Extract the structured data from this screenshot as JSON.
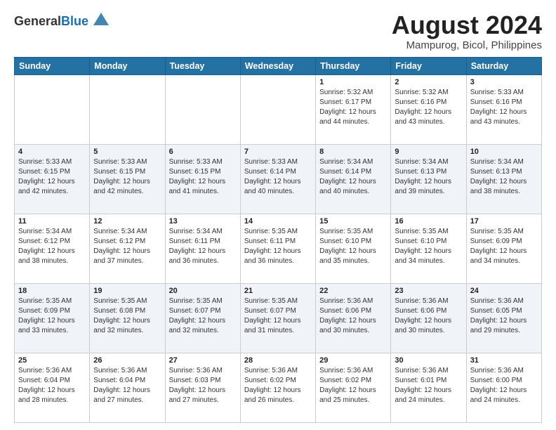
{
  "header": {
    "logo_general": "General",
    "logo_blue": "Blue",
    "month_year": "August 2024",
    "location": "Mampurog, Bicol, Philippines"
  },
  "weekdays": [
    "Sunday",
    "Monday",
    "Tuesday",
    "Wednesday",
    "Thursday",
    "Friday",
    "Saturday"
  ],
  "weeks": [
    [
      {
        "day": "",
        "info": ""
      },
      {
        "day": "",
        "info": ""
      },
      {
        "day": "",
        "info": ""
      },
      {
        "day": "",
        "info": ""
      },
      {
        "day": "1",
        "info": "Sunrise: 5:32 AM\nSunset: 6:17 PM\nDaylight: 12 hours\nand 44 minutes."
      },
      {
        "day": "2",
        "info": "Sunrise: 5:32 AM\nSunset: 6:16 PM\nDaylight: 12 hours\nand 43 minutes."
      },
      {
        "day": "3",
        "info": "Sunrise: 5:33 AM\nSunset: 6:16 PM\nDaylight: 12 hours\nand 43 minutes."
      }
    ],
    [
      {
        "day": "4",
        "info": "Sunrise: 5:33 AM\nSunset: 6:15 PM\nDaylight: 12 hours\nand 42 minutes."
      },
      {
        "day": "5",
        "info": "Sunrise: 5:33 AM\nSunset: 6:15 PM\nDaylight: 12 hours\nand 42 minutes."
      },
      {
        "day": "6",
        "info": "Sunrise: 5:33 AM\nSunset: 6:15 PM\nDaylight: 12 hours\nand 41 minutes."
      },
      {
        "day": "7",
        "info": "Sunrise: 5:33 AM\nSunset: 6:14 PM\nDaylight: 12 hours\nand 40 minutes."
      },
      {
        "day": "8",
        "info": "Sunrise: 5:34 AM\nSunset: 6:14 PM\nDaylight: 12 hours\nand 40 minutes."
      },
      {
        "day": "9",
        "info": "Sunrise: 5:34 AM\nSunset: 6:13 PM\nDaylight: 12 hours\nand 39 minutes."
      },
      {
        "day": "10",
        "info": "Sunrise: 5:34 AM\nSunset: 6:13 PM\nDaylight: 12 hours\nand 38 minutes."
      }
    ],
    [
      {
        "day": "11",
        "info": "Sunrise: 5:34 AM\nSunset: 6:12 PM\nDaylight: 12 hours\nand 38 minutes."
      },
      {
        "day": "12",
        "info": "Sunrise: 5:34 AM\nSunset: 6:12 PM\nDaylight: 12 hours\nand 37 minutes."
      },
      {
        "day": "13",
        "info": "Sunrise: 5:34 AM\nSunset: 6:11 PM\nDaylight: 12 hours\nand 36 minutes."
      },
      {
        "day": "14",
        "info": "Sunrise: 5:35 AM\nSunset: 6:11 PM\nDaylight: 12 hours\nand 36 minutes."
      },
      {
        "day": "15",
        "info": "Sunrise: 5:35 AM\nSunset: 6:10 PM\nDaylight: 12 hours\nand 35 minutes."
      },
      {
        "day": "16",
        "info": "Sunrise: 5:35 AM\nSunset: 6:10 PM\nDaylight: 12 hours\nand 34 minutes."
      },
      {
        "day": "17",
        "info": "Sunrise: 5:35 AM\nSunset: 6:09 PM\nDaylight: 12 hours\nand 34 minutes."
      }
    ],
    [
      {
        "day": "18",
        "info": "Sunrise: 5:35 AM\nSunset: 6:09 PM\nDaylight: 12 hours\nand 33 minutes."
      },
      {
        "day": "19",
        "info": "Sunrise: 5:35 AM\nSunset: 6:08 PM\nDaylight: 12 hours\nand 32 minutes."
      },
      {
        "day": "20",
        "info": "Sunrise: 5:35 AM\nSunset: 6:07 PM\nDaylight: 12 hours\nand 32 minutes."
      },
      {
        "day": "21",
        "info": "Sunrise: 5:35 AM\nSunset: 6:07 PM\nDaylight: 12 hours\nand 31 minutes."
      },
      {
        "day": "22",
        "info": "Sunrise: 5:36 AM\nSunset: 6:06 PM\nDaylight: 12 hours\nand 30 minutes."
      },
      {
        "day": "23",
        "info": "Sunrise: 5:36 AM\nSunset: 6:06 PM\nDaylight: 12 hours\nand 30 minutes."
      },
      {
        "day": "24",
        "info": "Sunrise: 5:36 AM\nSunset: 6:05 PM\nDaylight: 12 hours\nand 29 minutes."
      }
    ],
    [
      {
        "day": "25",
        "info": "Sunrise: 5:36 AM\nSunset: 6:04 PM\nDaylight: 12 hours\nand 28 minutes."
      },
      {
        "day": "26",
        "info": "Sunrise: 5:36 AM\nSunset: 6:04 PM\nDaylight: 12 hours\nand 27 minutes."
      },
      {
        "day": "27",
        "info": "Sunrise: 5:36 AM\nSunset: 6:03 PM\nDaylight: 12 hours\nand 27 minutes."
      },
      {
        "day": "28",
        "info": "Sunrise: 5:36 AM\nSunset: 6:02 PM\nDaylight: 12 hours\nand 26 minutes."
      },
      {
        "day": "29",
        "info": "Sunrise: 5:36 AM\nSunset: 6:02 PM\nDaylight: 12 hours\nand 25 minutes."
      },
      {
        "day": "30",
        "info": "Sunrise: 5:36 AM\nSunset: 6:01 PM\nDaylight: 12 hours\nand 24 minutes."
      },
      {
        "day": "31",
        "info": "Sunrise: 5:36 AM\nSunset: 6:00 PM\nDaylight: 12 hours\nand 24 minutes."
      }
    ]
  ]
}
